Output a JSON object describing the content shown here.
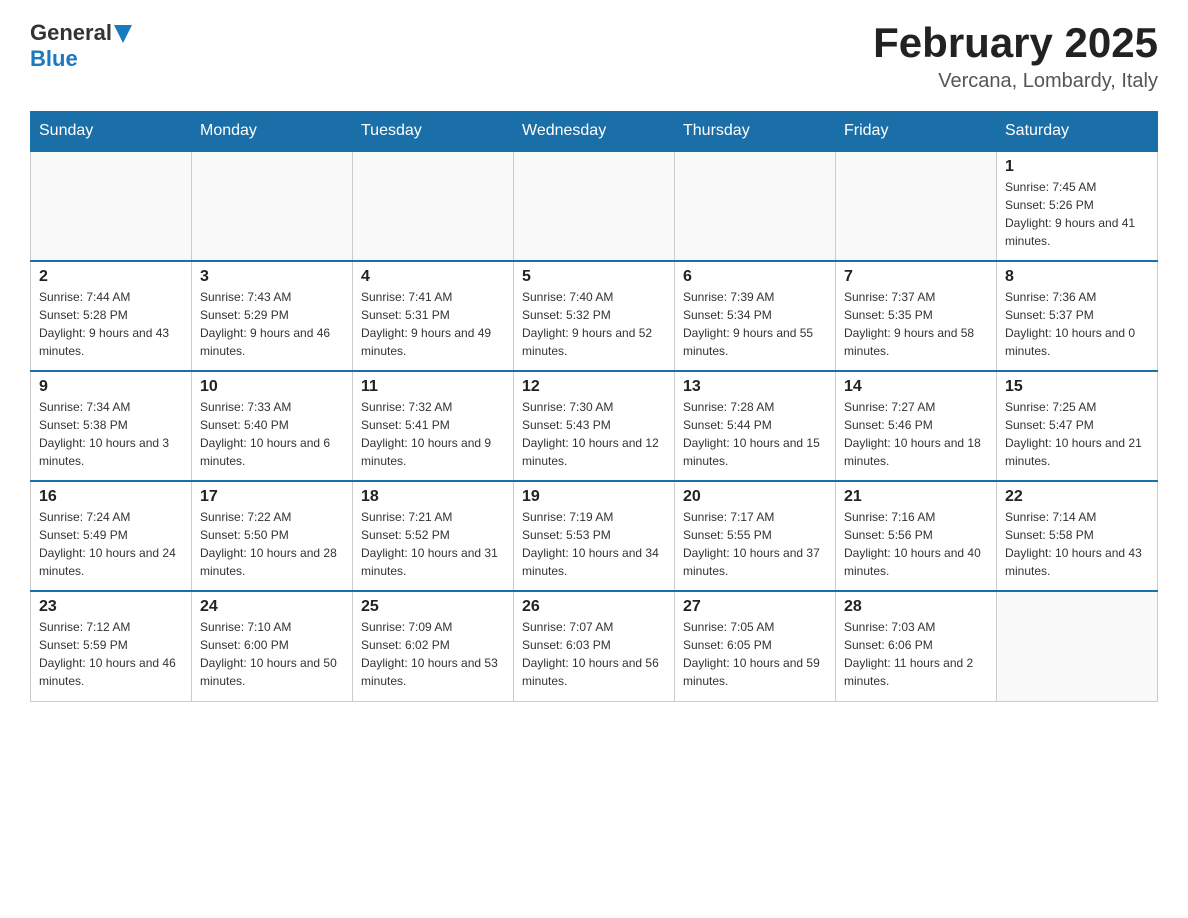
{
  "header": {
    "logo_general": "General",
    "logo_blue": "Blue",
    "month_title": "February 2025",
    "location": "Vercana, Lombardy, Italy"
  },
  "days_of_week": [
    "Sunday",
    "Monday",
    "Tuesday",
    "Wednesday",
    "Thursday",
    "Friday",
    "Saturday"
  ],
  "weeks": [
    [
      {
        "day": "",
        "info": ""
      },
      {
        "day": "",
        "info": ""
      },
      {
        "day": "",
        "info": ""
      },
      {
        "day": "",
        "info": ""
      },
      {
        "day": "",
        "info": ""
      },
      {
        "day": "",
        "info": ""
      },
      {
        "day": "1",
        "info": "Sunrise: 7:45 AM\nSunset: 5:26 PM\nDaylight: 9 hours and 41 minutes."
      }
    ],
    [
      {
        "day": "2",
        "info": "Sunrise: 7:44 AM\nSunset: 5:28 PM\nDaylight: 9 hours and 43 minutes."
      },
      {
        "day": "3",
        "info": "Sunrise: 7:43 AM\nSunset: 5:29 PM\nDaylight: 9 hours and 46 minutes."
      },
      {
        "day": "4",
        "info": "Sunrise: 7:41 AM\nSunset: 5:31 PM\nDaylight: 9 hours and 49 minutes."
      },
      {
        "day": "5",
        "info": "Sunrise: 7:40 AM\nSunset: 5:32 PM\nDaylight: 9 hours and 52 minutes."
      },
      {
        "day": "6",
        "info": "Sunrise: 7:39 AM\nSunset: 5:34 PM\nDaylight: 9 hours and 55 minutes."
      },
      {
        "day": "7",
        "info": "Sunrise: 7:37 AM\nSunset: 5:35 PM\nDaylight: 9 hours and 58 minutes."
      },
      {
        "day": "8",
        "info": "Sunrise: 7:36 AM\nSunset: 5:37 PM\nDaylight: 10 hours and 0 minutes."
      }
    ],
    [
      {
        "day": "9",
        "info": "Sunrise: 7:34 AM\nSunset: 5:38 PM\nDaylight: 10 hours and 3 minutes."
      },
      {
        "day": "10",
        "info": "Sunrise: 7:33 AM\nSunset: 5:40 PM\nDaylight: 10 hours and 6 minutes."
      },
      {
        "day": "11",
        "info": "Sunrise: 7:32 AM\nSunset: 5:41 PM\nDaylight: 10 hours and 9 minutes."
      },
      {
        "day": "12",
        "info": "Sunrise: 7:30 AM\nSunset: 5:43 PM\nDaylight: 10 hours and 12 minutes."
      },
      {
        "day": "13",
        "info": "Sunrise: 7:28 AM\nSunset: 5:44 PM\nDaylight: 10 hours and 15 minutes."
      },
      {
        "day": "14",
        "info": "Sunrise: 7:27 AM\nSunset: 5:46 PM\nDaylight: 10 hours and 18 minutes."
      },
      {
        "day": "15",
        "info": "Sunrise: 7:25 AM\nSunset: 5:47 PM\nDaylight: 10 hours and 21 minutes."
      }
    ],
    [
      {
        "day": "16",
        "info": "Sunrise: 7:24 AM\nSunset: 5:49 PM\nDaylight: 10 hours and 24 minutes."
      },
      {
        "day": "17",
        "info": "Sunrise: 7:22 AM\nSunset: 5:50 PM\nDaylight: 10 hours and 28 minutes."
      },
      {
        "day": "18",
        "info": "Sunrise: 7:21 AM\nSunset: 5:52 PM\nDaylight: 10 hours and 31 minutes."
      },
      {
        "day": "19",
        "info": "Sunrise: 7:19 AM\nSunset: 5:53 PM\nDaylight: 10 hours and 34 minutes."
      },
      {
        "day": "20",
        "info": "Sunrise: 7:17 AM\nSunset: 5:55 PM\nDaylight: 10 hours and 37 minutes."
      },
      {
        "day": "21",
        "info": "Sunrise: 7:16 AM\nSunset: 5:56 PM\nDaylight: 10 hours and 40 minutes."
      },
      {
        "day": "22",
        "info": "Sunrise: 7:14 AM\nSunset: 5:58 PM\nDaylight: 10 hours and 43 minutes."
      }
    ],
    [
      {
        "day": "23",
        "info": "Sunrise: 7:12 AM\nSunset: 5:59 PM\nDaylight: 10 hours and 46 minutes."
      },
      {
        "day": "24",
        "info": "Sunrise: 7:10 AM\nSunset: 6:00 PM\nDaylight: 10 hours and 50 minutes."
      },
      {
        "day": "25",
        "info": "Sunrise: 7:09 AM\nSunset: 6:02 PM\nDaylight: 10 hours and 53 minutes."
      },
      {
        "day": "26",
        "info": "Sunrise: 7:07 AM\nSunset: 6:03 PM\nDaylight: 10 hours and 56 minutes."
      },
      {
        "day": "27",
        "info": "Sunrise: 7:05 AM\nSunset: 6:05 PM\nDaylight: 10 hours and 59 minutes."
      },
      {
        "day": "28",
        "info": "Sunrise: 7:03 AM\nSunset: 6:06 PM\nDaylight: 11 hours and 2 minutes."
      },
      {
        "day": "",
        "info": ""
      }
    ]
  ]
}
